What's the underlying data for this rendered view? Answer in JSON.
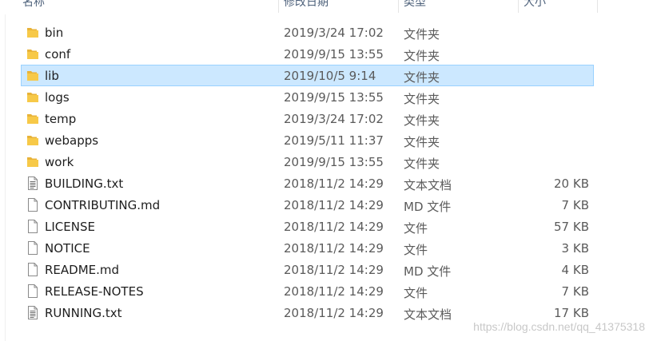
{
  "header": {
    "name": "名称",
    "date": "修改日期",
    "type": "类型",
    "size": "大小"
  },
  "colors": {
    "folder": "#f7c948",
    "selection_bg": "#cce8ff",
    "selection_border": "#99d1ff"
  },
  "files": [
    {
      "name": "bin",
      "date": "2019/3/24 17:02",
      "type": "文件夹",
      "size": "",
      "icon": "folder-icon"
    },
    {
      "name": "conf",
      "date": "2019/9/15 13:55",
      "type": "文件夹",
      "size": "",
      "icon": "folder-icon"
    },
    {
      "name": "lib",
      "date": "2019/10/5 9:14",
      "type": "文件夹",
      "size": "",
      "icon": "folder-icon",
      "selected": true
    },
    {
      "name": "logs",
      "date": "2019/9/15 13:55",
      "type": "文件夹",
      "size": "",
      "icon": "folder-icon"
    },
    {
      "name": "temp",
      "date": "2019/3/24 17:02",
      "type": "文件夹",
      "size": "",
      "icon": "folder-icon"
    },
    {
      "name": "webapps",
      "date": "2019/5/11 11:37",
      "type": "文件夹",
      "size": "",
      "icon": "folder-icon"
    },
    {
      "name": "work",
      "date": "2019/9/15 13:55",
      "type": "文件夹",
      "size": "",
      "icon": "folder-icon"
    },
    {
      "name": "BUILDING.txt",
      "date": "2018/11/2 14:29",
      "type": "文本文档",
      "size": "20 KB",
      "icon": "text-file-icon"
    },
    {
      "name": "CONTRIBUTING.md",
      "date": "2018/11/2 14:29",
      "type": "MD 文件",
      "size": "7 KB",
      "icon": "file-icon"
    },
    {
      "name": "LICENSE",
      "date": "2018/11/2 14:29",
      "type": "文件",
      "size": "57 KB",
      "icon": "file-icon"
    },
    {
      "name": "NOTICE",
      "date": "2018/11/2 14:29",
      "type": "文件",
      "size": "3 KB",
      "icon": "file-icon"
    },
    {
      "name": "README.md",
      "date": "2018/11/2 14:29",
      "type": "MD 文件",
      "size": "4 KB",
      "icon": "file-icon"
    },
    {
      "name": "RELEASE-NOTES",
      "date": "2018/11/2 14:29",
      "type": "文件",
      "size": "7 KB",
      "icon": "file-icon"
    },
    {
      "name": "RUNNING.txt",
      "date": "2018/11/2 14:29",
      "type": "文本文档",
      "size": "17 KB",
      "icon": "text-file-icon"
    }
  ],
  "watermark": "https://blog.csdn.net/qq_41375318"
}
